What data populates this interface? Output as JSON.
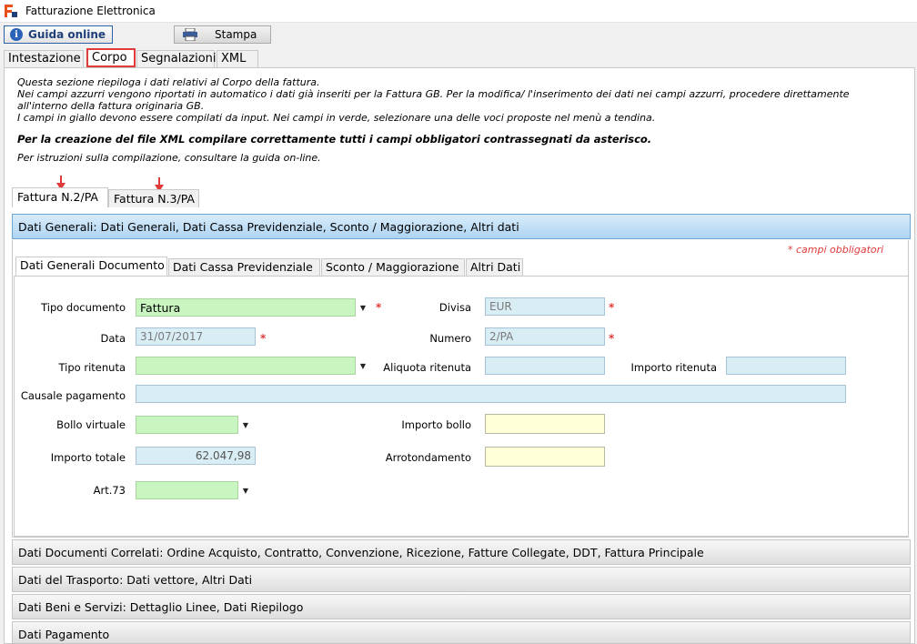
{
  "window": {
    "title": "Fatturazione Elettronica"
  },
  "toolbar": {
    "guida_label": "Guida online",
    "stampa_label": "Stampa"
  },
  "main_tabs": [
    {
      "label": "Intestazione"
    },
    {
      "label": "Corpo"
    },
    {
      "label": "Segnalazioni"
    },
    {
      "label": "XML"
    }
  ],
  "info": {
    "line1": "Questa sezione riepiloga i dati relativi al Corpo della fattura.",
    "line2": "Nei campi azzurri vengono riportati in automatico i dati già inseriti per la Fattura GB. Per la modifica/ l'inserimento dei dati nei campi azzurri, procedere direttamente",
    "line3": "all'interno della fattura originaria GB.",
    "line4": "I campi in giallo devono essere compilati da input. Nei campi in verde, selezionare una delle voci proposte nel menù a tendina.",
    "bold_line": "Per la creazione del file XML compilare correttamente tutti i campi obbligatori contrassegnati da asterisco.",
    "line5": "Per istruzioni sulla compilazione, consultare la guida on-line."
  },
  "fattura_tabs": [
    {
      "label": "Fattura N.2/PA"
    },
    {
      "label": "Fattura N.3/PA"
    }
  ],
  "sections": {
    "generali": "Dati Generali: Dati Generali, Dati Cassa Previdenziale, Sconto / Maggiorazione, Altri dati",
    "correlati": "Dati Documenti Correlati: Ordine Acquisto, Contratto, Convenzione, Ricezione, Fatture Collegate, DDT, Fattura Principale",
    "trasporto": "Dati del Trasporto: Dati vettore, Altri Dati",
    "beni": "Dati Beni e Servizi: Dettaglio Linee, Dati Riepilogo",
    "pagamento": "Dati Pagamento"
  },
  "required_note": "* campi obbligatori",
  "detail_tabs": [
    {
      "label": "Dati Generali Documento"
    },
    {
      "label": "Dati Cassa Previdenziale"
    },
    {
      "label": "Sconto / Maggiorazione"
    },
    {
      "label": "Altri Dati"
    }
  ],
  "form": {
    "tipo_documento": {
      "label": "Tipo documento",
      "value": "Fattura"
    },
    "divisa": {
      "label": "Divisa",
      "value": "EUR"
    },
    "data": {
      "label": "Data",
      "value": "31/07/2017"
    },
    "numero": {
      "label": "Numero",
      "value": "2/PA"
    },
    "tipo_ritenuta": {
      "label": "Tipo ritenuta",
      "value": ""
    },
    "aliquota_ritenuta": {
      "label": "Aliquota ritenuta",
      "value": ""
    },
    "importo_ritenuta": {
      "label": "Importo ritenuta",
      "value": ""
    },
    "causale_pagamento": {
      "label": "Causale pagamento",
      "value": ""
    },
    "bollo_virtuale": {
      "label": "Bollo virtuale",
      "value": ""
    },
    "importo_bollo": {
      "label": "Importo bollo",
      "value": ""
    },
    "importo_totale": {
      "label": "Importo totale",
      "value": "62.047,98"
    },
    "arrotondamento": {
      "label": "Arrotondamento",
      "value": ""
    },
    "art73": {
      "label": "Art.73",
      "value": ""
    },
    "required_star": "*"
  },
  "colors": {
    "required": "#e03a3a",
    "blue_field": "#d9edf5",
    "green_field": "#c8f5c0",
    "yellow_field": "#ffffd8"
  }
}
